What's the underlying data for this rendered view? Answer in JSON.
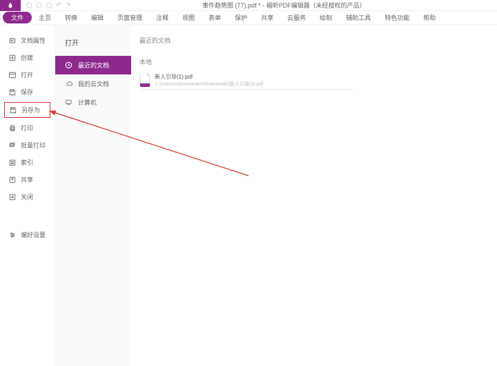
{
  "title": "事件趋势图 (77).pdf * - 福昕PDF编辑器（未经授权的产品）",
  "menus": [
    "文件",
    "主页",
    "转换",
    "编辑",
    "页面管理",
    "注释",
    "视图",
    "表单",
    "保护",
    "共享",
    "云服务",
    "绘制",
    "辅助工具",
    "特色功能",
    "帮助"
  ],
  "active_menu": 0,
  "sidebar": [
    {
      "icon": "props",
      "label": "文档属性"
    },
    {
      "icon": "create",
      "label": "创建"
    },
    {
      "icon": "open",
      "label": "打开"
    },
    {
      "icon": "save",
      "label": "保存"
    },
    {
      "icon": "saveas",
      "label": "另存为",
      "boxed": true
    },
    {
      "icon": "print",
      "label": "打印"
    },
    {
      "icon": "batch",
      "label": "批量打印"
    },
    {
      "icon": "index",
      "label": "索引"
    },
    {
      "icon": "share",
      "label": "共享"
    },
    {
      "icon": "close",
      "label": "关闭"
    }
  ],
  "sidebar_bottom": {
    "icon": "prefs",
    "label": "偏好设置"
  },
  "mid_header": "打开",
  "mid_items": [
    {
      "icon": "clock",
      "label": "最近的文档",
      "active": true
    },
    {
      "icon": "cloud",
      "label": "我的云文档"
    },
    {
      "icon": "computer",
      "label": "计算机"
    }
  ],
  "content_header": "最近的文档",
  "section_label": "本地",
  "file": {
    "name": "新人引导(1).pdf",
    "path": "C:\\Users\\Administrator\\Downloads\\新人引导(1).pdf"
  }
}
